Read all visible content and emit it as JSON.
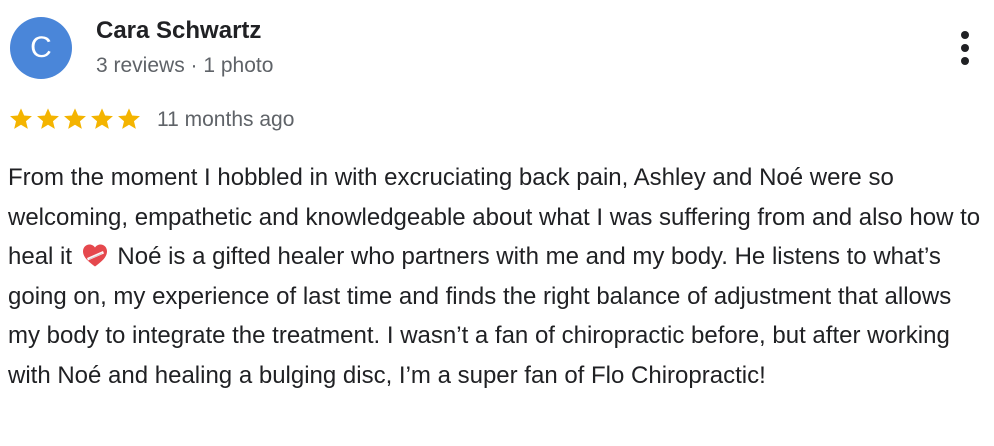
{
  "reviewer": {
    "avatar_letter": "C",
    "avatar_color": "#4a86d9",
    "name": "Cara Schwartz",
    "meta": "3 reviews · 1 photo"
  },
  "rating": {
    "stars": 5,
    "max_stars": 5,
    "star_color": "#f4b400",
    "date": "11 months ago"
  },
  "menu": {
    "icon": "more-vert-icon"
  },
  "review": {
    "text_part1": "From the moment I hobbled in with excruciating back pain, Ashley and Noé were so welcoming, empathetic and knowledgeable about what I was suffering from and also how to heal it",
    "emoji": "mending-heart-icon",
    "text_part2": "Noé is a gifted healer who partners with me and my body. He listens to what’s going on, my experience of last time and finds the right balance of adjustment that allows my body to integrate the treatment. I wasn’t a fan of chiropractic before, but after working with Noé and healing a bulging disc, I’m a super fan of Flo Chiropractic!"
  }
}
